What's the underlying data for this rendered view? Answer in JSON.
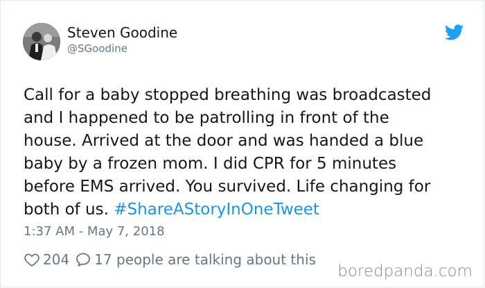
{
  "author": {
    "name": "Steven Goodine",
    "handle": "@SGoodine"
  },
  "tweet": {
    "lines": [
      "Call for a baby stopped breathing was broadcasted",
      "and I happened to be patrolling in front of the",
      "house. Arrived at the door and was handed a blue",
      "baby by a frozen mom. I did CPR for 5 minutes",
      "before EMS arrived. You survived. Life changing for"
    ],
    "last_line_text": "both of us. ",
    "hashtag": "#ShareAStoryInOneTweet",
    "timestamp": "1:37 AM - May 7, 2018"
  },
  "actions": {
    "like_count": "204",
    "reply_count": "17 people are talking about this"
  },
  "watermark": "boredpanda.com",
  "icons": {
    "brand": "twitter-bird-icon",
    "like": "heart-icon",
    "reply": "speech-bubble-icon"
  },
  "colors": {
    "link": "#1b95e0",
    "brand": "#1da1f2",
    "meta": "#657786",
    "text": "#14171a"
  }
}
